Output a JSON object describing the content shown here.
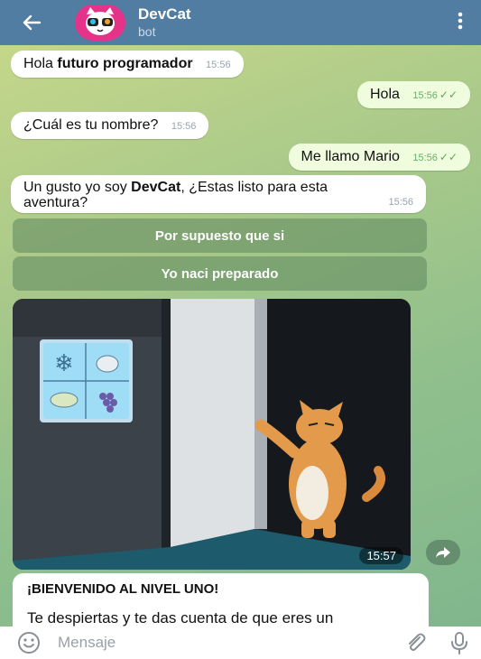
{
  "header": {
    "title": "DevCat",
    "subtitle": "bot"
  },
  "messages": [
    {
      "text_prefix": "Hola ",
      "text_bold": "futuro programador",
      "time": "15:56"
    },
    {
      "text": "Hola",
      "time": "15:56"
    },
    {
      "text": "¿Cuál es tu nombre?",
      "time": "15:56"
    },
    {
      "text": "Me llamo Mario",
      "time": "15:56"
    },
    {
      "line1_prefix": "Un gusto yo soy ",
      "line1_bold": "DevCat",
      "line1_suffix": ", ¿Estas listo para esta",
      "line2": "aventura?",
      "time": "15:56"
    }
  ],
  "keyboard": {
    "option1": "Por supuesto que si",
    "option2": "Yo naci preparado"
  },
  "photo": {
    "time": "15:57"
  },
  "caption": {
    "title": "¡BIENVENIDO AL NIVEL UNO!",
    "text": "Te despiertas y te das cuenta de que eres un"
  },
  "input": {
    "placeholder": "Mensaje"
  },
  "colors": {
    "header": "#517da2",
    "outgoing": "#effdde",
    "incoming": "#ffffff"
  }
}
